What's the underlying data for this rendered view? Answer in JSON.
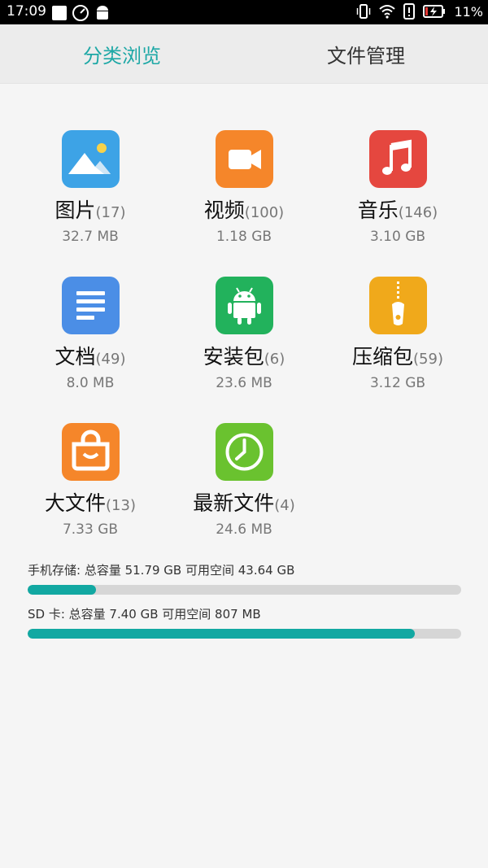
{
  "status_bar": {
    "time": "17:09",
    "battery_percent": "11%",
    "icons": [
      "notification-square-icon",
      "speedometer-icon",
      "android-icon",
      "vibrate-icon",
      "wifi-icon",
      "alert-icon",
      "battery-charging-icon"
    ]
  },
  "tabs": [
    {
      "label": "分类浏览",
      "active": true
    },
    {
      "label": "文件管理",
      "active": false
    }
  ],
  "categories": [
    {
      "name": "图片",
      "count": "(17)",
      "size": "32.7 MB",
      "icon": "image-icon",
      "color": "#3da3e6"
    },
    {
      "name": "视频",
      "count": "(100)",
      "size": "1.18 GB",
      "icon": "video-icon",
      "color": "#f5862a"
    },
    {
      "name": "音乐",
      "count": "(146)",
      "size": "3.10 GB",
      "icon": "music-icon",
      "color": "#e5473f"
    },
    {
      "name": "文档",
      "count": "(49)",
      "size": "8.0 MB",
      "icon": "document-icon",
      "color": "#4b8ee6"
    },
    {
      "name": "安装包",
      "count": "(6)",
      "size": "23.6 MB",
      "icon": "android-package-icon",
      "color": "#22b25c"
    },
    {
      "name": "压缩包",
      "count": "(59)",
      "size": "3.12 GB",
      "icon": "zip-icon",
      "color": "#f0a91b"
    },
    {
      "name": "大文件",
      "count": "(13)",
      "size": "7.33 GB",
      "icon": "shopping-bag-icon",
      "color": "#f5862a"
    },
    {
      "name": "最新文件",
      "count": "(4)",
      "size": "24.6 MB",
      "icon": "clock-icon",
      "color": "#6ac22f"
    }
  ],
  "storage": {
    "phone": {
      "label": "手机存储: 总容量 51.79 GB  可用空间 43.64 GB",
      "used_fraction": 0.157
    },
    "sd": {
      "label": "SD 卡: 总容量 7.40 GB  可用空间 807 MB",
      "used_fraction": 0.893
    }
  }
}
